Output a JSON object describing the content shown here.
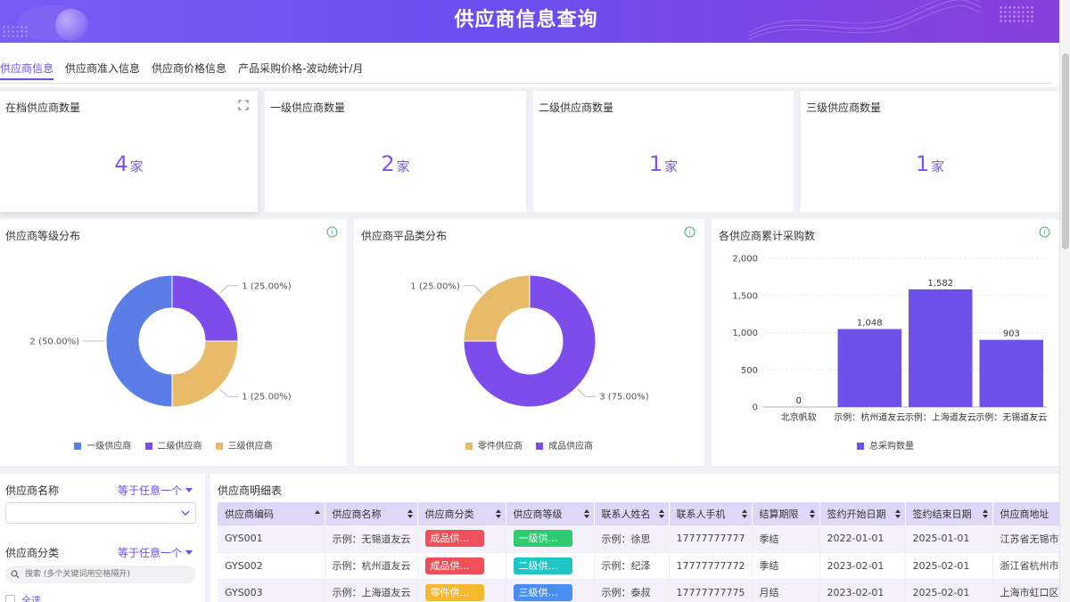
{
  "header": {
    "title": "供应商信息查询"
  },
  "tabs": [
    {
      "label": "供应商信息",
      "active": true
    },
    {
      "label": "供应商准入信息",
      "active": false
    },
    {
      "label": "供应商价格信息",
      "active": false
    },
    {
      "label": "产品采购价格-波动统计/月",
      "active": false
    }
  ],
  "stats": [
    {
      "title": "在档供应商数量",
      "value": "4",
      "unit": "家"
    },
    {
      "title": "一级供应商数量",
      "value": "2",
      "unit": "家"
    },
    {
      "title": "二级供应商数量",
      "value": "1",
      "unit": "家"
    },
    {
      "title": "三级供应商数量",
      "value": "1",
      "unit": "家"
    }
  ],
  "colors": {
    "accent": "#6b4ef0",
    "blue": "#5b7ee6",
    "purple": "#7d4cea",
    "gold": "#e8bb6a"
  },
  "chart_data": [
    {
      "type": "pie",
      "title": "供应商等级分布",
      "slices": [
        {
          "name": "一级供应商",
          "value": 2,
          "label": "2 (50.00%)",
          "color": "#5b7ee6"
        },
        {
          "name": "二级供应商",
          "value": 1,
          "label": "1 (25.00%)",
          "color": "#7d4cea"
        },
        {
          "name": "三级供应商",
          "value": 1,
          "label": "1 (25.00%)",
          "color": "#e8bb6a"
        }
      ]
    },
    {
      "type": "pie",
      "title": "供应商平品类分布",
      "slices": [
        {
          "name": "零件供应商",
          "value": 1,
          "label": "1 (25.00%)",
          "color": "#e8bb6a"
        },
        {
          "name": "成品供应商",
          "value": 3,
          "label": "3 (75.00%)",
          "color": "#7d4cea"
        }
      ]
    },
    {
      "type": "bar",
      "title": "各供应商累计采购数",
      "categories": [
        "北京帆软",
        "示例：杭州道友云",
        "示例：上海道友云",
        "示例：无锡道友云"
      ],
      "series": [
        {
          "name": "总采购数量",
          "values": [
            0,
            1048,
            1582,
            903
          ],
          "color": "#7050ea"
        }
      ],
      "ylim": [
        0,
        2000
      ],
      "yticks": [
        "2,000",
        "1,500",
        "1,000",
        "500",
        "0"
      ],
      "data_labels": [
        "0",
        "1,048",
        "1,582",
        "903"
      ],
      "grid": true,
      "legend": "bottom"
    }
  ],
  "filters": {
    "name_label": "供应商名称",
    "name_op": "等于任意一个",
    "category_label": "供应商分类",
    "category_op": "等于任意一个",
    "search_placeholder": "搜索 (多个关键词用空格隔开)",
    "select_all": "全选"
  },
  "detail": {
    "title": "供应商明细表",
    "columns": [
      "供应商编码",
      "供应商名称",
      "供应商分类",
      "供应商等级",
      "联系人姓名",
      "联系人手机",
      "结算期限",
      "签约开始日期",
      "签约结束日期",
      "供应商地址"
    ],
    "rows": [
      {
        "code": "GYS001",
        "name": "示例：无锡道友云",
        "category": "成品供应...",
        "category_color": "#f0505a",
        "level": "一级供应商",
        "level_color": "#2ecc71",
        "contact": "示例：徐思",
        "phone": "17777777777",
        "term": "季结",
        "start": "2022-01-01",
        "end": "2025-01-01",
        "address": "江苏省无锡市"
      },
      {
        "code": "GYS002",
        "name": "示例：杭州道友云",
        "category": "成品供应...",
        "category_color": "#f0505a",
        "level": "二级供应商",
        "level_color": "#1ec6c6",
        "contact": "示例：纪泽",
        "phone": "17777777772",
        "term": "季结",
        "start": "2023-02-01",
        "end": "2025-02-01",
        "address": "浙江省杭州市"
      },
      {
        "code": "GYS003",
        "name": "示例：上海道友云",
        "category": "零件供应...",
        "category_color": "#f5b82e",
        "level": "三级供应商",
        "level_color": "#4a8ff0",
        "contact": "示例：泰叔",
        "phone": "17777777775",
        "term": "月结",
        "start": "2023-02-01",
        "end": "2025-02-01",
        "address": "上海市虹口区"
      }
    ]
  }
}
